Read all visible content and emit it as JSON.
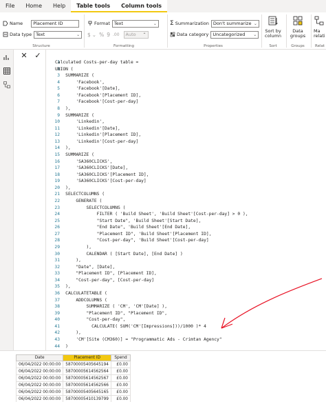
{
  "menu": {
    "tabs": [
      "File",
      "Home",
      "Help",
      "Table tools",
      "Column tools"
    ],
    "active_tab": "Column tools"
  },
  "ribbon": {
    "structure": {
      "name_label": "Name",
      "name_value": "Placement ID",
      "datatype_label": "Data type",
      "datatype_value": "Text",
      "group_label": "Structure"
    },
    "formatting": {
      "format_label": "Format",
      "format_value": "Text",
      "currency_symbol": "$",
      "percent_symbol": "%",
      "comma_symbol": "9",
      "decimals": ".00",
      "auto_value": "Auto",
      "group_label": "Formatting"
    },
    "properties": {
      "summarization_label": "Summarization",
      "summarization_value": "Don't summarize",
      "category_label": "Data category",
      "category_value": "Uncategorized",
      "group_label": "Properties"
    },
    "sort": {
      "button_label_1": "Sort by",
      "button_label_2": "column",
      "group_label": "Sort"
    },
    "groups": {
      "button_label_1": "Data",
      "button_label_2": "groups",
      "group_label": "Groups"
    },
    "relationships": {
      "button_label_1": "Ma",
      "button_label_2": "relati",
      "group_label": "Relat"
    }
  },
  "formula": {
    "lines": [
      {
        "n": "1",
        "text": "Calculated Costs-per-day table ="
      },
      {
        "n": "2",
        "text": "UNION ("
      },
      {
        "n": "3",
        "text": "    SUMMARIZE ("
      },
      {
        "n": "4",
        "text": "        'Facebook',"
      },
      {
        "n": "5",
        "text": "        'Facebook'[Date],"
      },
      {
        "n": "6",
        "text": "        'Facebook'[Placement ID],"
      },
      {
        "n": "7",
        "text": "        'Facebook'[Cost-per-day]"
      },
      {
        "n": "8",
        "text": "    ),"
      },
      {
        "n": "9",
        "text": "    SUMMARIZE ("
      },
      {
        "n": "10",
        "text": "        'Linkedin',"
      },
      {
        "n": "11",
        "text": "        'Linkedin'[Date],"
      },
      {
        "n": "12",
        "text": "        'Linkedin'[Placement ID],"
      },
      {
        "n": "13",
        "text": "        'Linkedin'[Cost-per-day]"
      },
      {
        "n": "14",
        "text": "    ),"
      },
      {
        "n": "15",
        "text": "    SUMMARIZE ("
      },
      {
        "n": "16",
        "text": "        'SA360CLICKS',"
      },
      {
        "n": "17",
        "text": "        'SA360CLICKS'[Date],"
      },
      {
        "n": "18",
        "text": "        'SA360CLICKS'[Placement ID],"
      },
      {
        "n": "19",
        "text": "        'SA360CLICKS'[Cost-per-day]"
      },
      {
        "n": "20",
        "text": "    ),"
      },
      {
        "n": "21",
        "text": "    SELECTCOLUMNS ("
      },
      {
        "n": "22",
        "text": "        GENERATE ("
      },
      {
        "n": "23",
        "text": "            SELECTCOLUMNS ("
      },
      {
        "n": "24",
        "text": "                FILTER ( 'Build Sheet', 'Build Sheet'[Cost-per-day] > 0 ),"
      },
      {
        "n": "25",
        "text": "                \"Start Date\", 'Build Sheet'[Start Date],"
      },
      {
        "n": "26",
        "text": "                \"End Date\", 'Build Sheet'[End Date],"
      },
      {
        "n": "27",
        "text": "                \"Placement ID\", 'Build Sheet'[Placement ID],"
      },
      {
        "n": "28",
        "text": "                \"Cost-per-day\", 'Build Sheet'[Cost-per-day]"
      },
      {
        "n": "29",
        "text": "            ),"
      },
      {
        "n": "30",
        "text": "            CALENDAR ( [Start Date], [End Date] )"
      },
      {
        "n": "31",
        "text": "        ),"
      },
      {
        "n": "32",
        "text": "        \"Date\", [Date],"
      },
      {
        "n": "33",
        "text": "        \"Placement ID\", [Placement ID],"
      },
      {
        "n": "34",
        "text": "        \"Cost-per-day\", [Cost-per-day]"
      },
      {
        "n": "35",
        "text": "    ),"
      },
      {
        "n": "36",
        "text": "    CALCULATETABLE ("
      },
      {
        "n": "37",
        "text": "        ADDCOLUMNS ("
      },
      {
        "n": "38",
        "text": "            SUMMARIZE ( 'CM', 'CM'[Date] ),"
      },
      {
        "n": "39",
        "text": "            \"Placement ID\", \"Placement ID\","
      },
      {
        "n": "40",
        "text": "            \"Cost-per-day\","
      },
      {
        "n": "41",
        "text": "              CALCULATE( SUM('CM'[Impressions]))/1000 )* 4"
      },
      {
        "n": "42",
        "text": "        ),"
      },
      {
        "n": "43",
        "text": "        'CM'[Site (CM360)] = \"Programmatic Ads - Crimtan Agency\""
      },
      {
        "n": "44",
        "text": "    )"
      },
      {
        "n": "45",
        "text": ")"
      }
    ]
  },
  "table": {
    "headers": [
      "Date",
      "Placement ID",
      "Spend"
    ],
    "rows": [
      [
        "06/04/2022 00:00:00",
        "587000054056451​94",
        "£0.00"
      ],
      [
        "06/04/2022 00:00:00",
        "58700005614562564",
        "£0.00"
      ],
      [
        "06/04/2022 00:00:00",
        "58700005614562567",
        "£0.00"
      ],
      [
        "06/04/2022 00:00:00",
        "58700005614562566",
        "£0.00"
      ],
      [
        "06/04/2022 00:00:00",
        "58700005405645165",
        "£0.00"
      ],
      [
        "06/04/2022 00:00:00",
        "58700005410139799",
        "£0.00"
      ]
    ]
  },
  "colors": {
    "accent": "#f2c811",
    "annotation": "#e81123"
  }
}
